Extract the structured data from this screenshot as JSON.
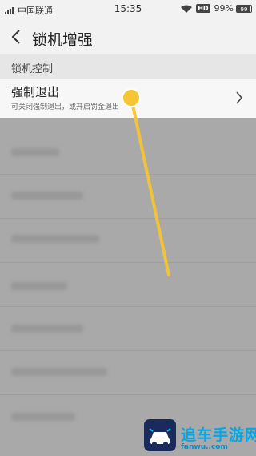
{
  "status_bar": {
    "carrier": "中国联通",
    "time": "15:35",
    "hd": "HD",
    "battery_pct": "99%",
    "battery_level": "99"
  },
  "header": {
    "title": "锁机增强",
    "back_icon": "chevron-left-icon"
  },
  "section": {
    "title": "锁机控制"
  },
  "item": {
    "title": "强制退出",
    "subtitle": "可关闭强制退出，或开启罚金退出",
    "chevron_icon": "chevron-right-icon"
  },
  "gesture": {
    "color": "#f5c533"
  },
  "watermark": {
    "brand": "追车手游网",
    "url": "fanwu..com"
  }
}
